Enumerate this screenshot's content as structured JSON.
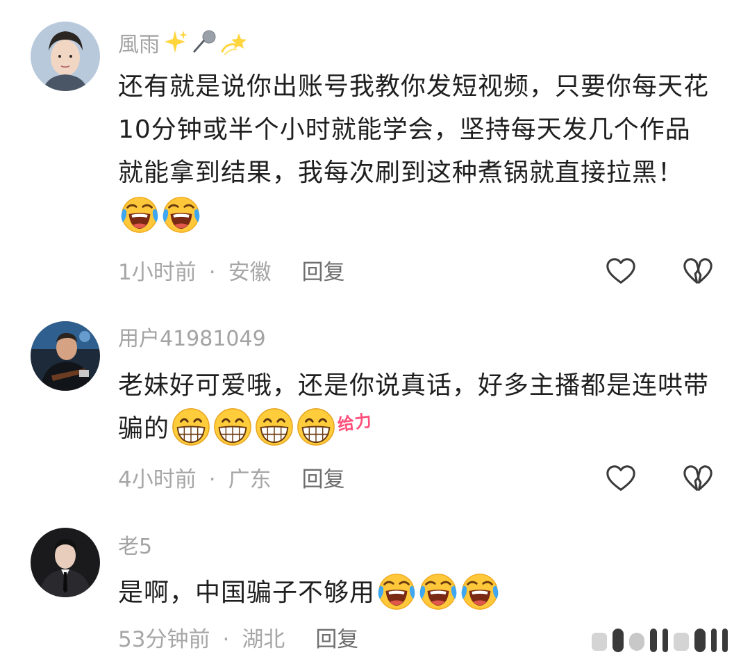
{
  "comments": [
    {
      "username": "風雨",
      "username_emojis": [
        "sparkles-icon",
        "microphone-icon",
        "dizzy-star-icon"
      ],
      "text": "还有就是说你出账号我教你发短视频，只要你每天花10分钟或半个小时就能学会，坚持每天发几个作品就能拿到结果，我每次刷到这种煮锅就直接拉黑！",
      "emojis": [
        "laugh-cry-emoji",
        "laugh-cry-emoji"
      ],
      "time": "1小时前",
      "location": "安徽",
      "reply_label": "回复",
      "dot": "·"
    },
    {
      "username": "用户41981049",
      "text": "老妹好可爱哦，还是你说真话，好多主播都是连哄带骗的",
      "emojis": [
        "grin-emoji",
        "grin-emoji",
        "grin-emoji",
        "grin-emoji"
      ],
      "sticker_text": "给力",
      "time": "4小时前",
      "location": "广东",
      "reply_label": "回复",
      "dot": "·"
    },
    {
      "username": "老5",
      "text": "是啊，中国骗子不够用",
      "emojis": [
        "laugh-cry-emoji",
        "laugh-cry-emoji",
        "laugh-cry-emoji"
      ],
      "time": "53分钟前",
      "location": "湖北",
      "reply_label": "回复",
      "dot": "·"
    }
  ],
  "icons": {
    "like": "heart-outline-icon",
    "dislike": "broken-heart-outline-icon"
  },
  "colors": {
    "username": "#a3a3a3",
    "meta": "#a6a6a6",
    "reply": "#6e6e6e",
    "body": "#1f1f1f",
    "icon_stroke": "#3a3a3a",
    "sticker": "#ff4f7b"
  }
}
